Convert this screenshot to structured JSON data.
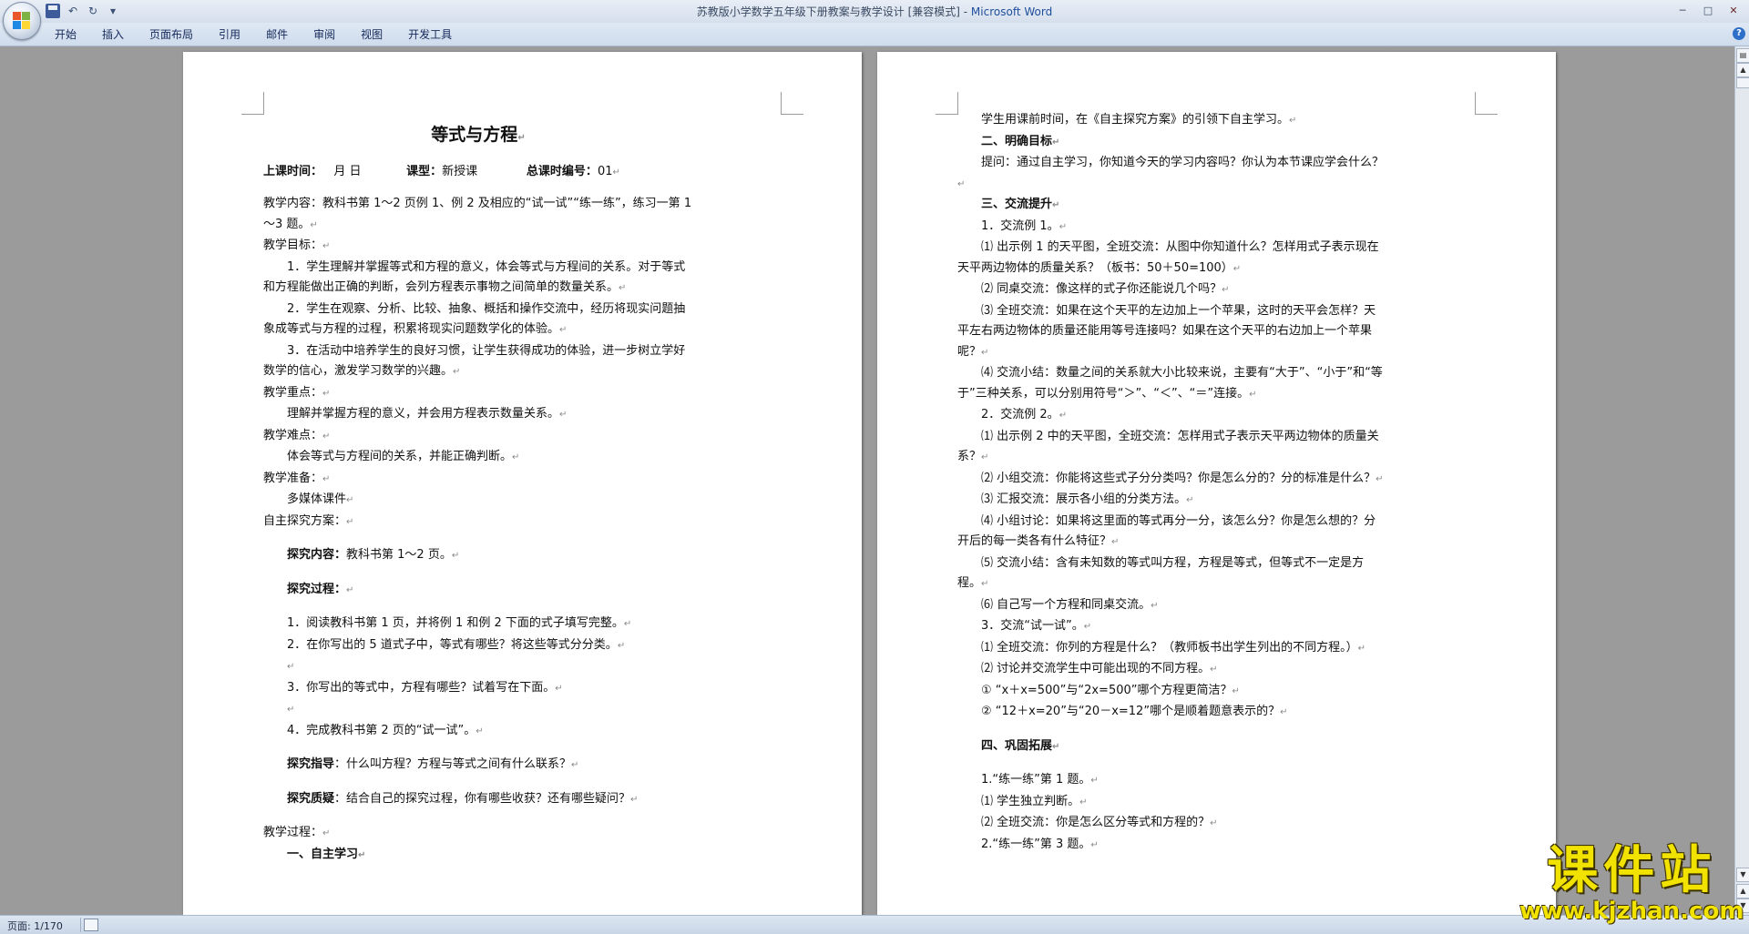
{
  "titlebar": {
    "doc_title": "苏教版小学数学五年级下册教案与教学设计 [兼容模式] - ",
    "app_name": "Microsoft Word",
    "qat_arrow": "▾",
    "minimize": "─",
    "maximize": "□",
    "close": "✕"
  },
  "ribbon": {
    "tabs": [
      "开始",
      "插入",
      "页面布局",
      "引用",
      "邮件",
      "审阅",
      "视图",
      "开发工具"
    ],
    "help": "?"
  },
  "left_page": {
    "title": "等式与方程",
    "info": {
      "time_label": "上课时间：",
      "time_value": "月  日",
      "type_label": "课型：",
      "type_value": "新授课",
      "num_label": "总课时编号：",
      "num_value": "01"
    },
    "lines": [
      "教学内容：教科书第 1～2 页例 1、例 2 及相应的“试一试”“练一练”，练习一第 1～3 题。",
      "教学目标：",
      "1．学生理解并掌握等式和方程的意义，体会等式与方程间的关系。对于等式和方程能做出正确的判断，会列方程表示事物之间简单的数量关系。",
      "2．学生在观察、分析、比较、抽象、概括和操作交流中，经历将现实问题抽象成等式与方程的过程，积累将现实问题数学化的体验。",
      "3．在活动中培养学生的良好习惯，让学生获得成功的体验，进一步树立学好数学的信心，激发学习数学的兴趣。",
      "教学重点：",
      "理解并掌握方程的意义，并会用方程表示数量关系。",
      "教学难点：",
      "体会等式与方程间的关系，并能正确判断。",
      "教学准备：",
      "多媒体课件",
      "自主探究方案："
    ],
    "explore_content_label": "探究内容：",
    "explore_content": "教科书第 1～2 页。",
    "explore_process_label": "探究过程：",
    "steps": [
      "1．阅读教科书第 1 页，并将例 1 和例 2 下面的式子填写完整。",
      "2．在你写出的 5 道式子中，等式有哪些？将这些等式分分类。",
      "3．你写出的等式中，方程有哪些？试着写在下面。",
      "4．完成教科书第 2 页的“试一试”。"
    ],
    "guide_label": "探究指导",
    "guide_text": "：什么叫方程？方程与等式之间有什么联系？",
    "question_label": "探究质疑",
    "question_text": "：结合自己的探究过程，你有哪些收获？还有哪些疑问？",
    "process_label": "教学过程：",
    "section1": "一、自主学习"
  },
  "right_page": {
    "lines": [
      "学生用课前时间，在《自主探究方案》的引领下自主学习。",
      "二、明确目标",
      "提问：通过自主学习，你知道今天的学习内容吗？你认为本节课应学会什么？",
      "三、交流提升",
      "1．交流例 1。",
      "⑴ 出示例 1 的天平图，全班交流：从图中你知道什么？怎样用式子表示现在天平两边物体的质量关系？（板书：50＋50=100）",
      "⑵ 同桌交流：像这样的式子你还能说几个吗？",
      "⑶ 全班交流：如果在这个天平的左边加上一个苹果，这时的天平会怎样？天平左右两边物体的质量还能用等号连接吗？如果在这个天平的右边加上一个苹果呢？",
      "⑷ 交流小结：数量之间的关系就大小比较来说，主要有“大于”、“小于”和“等于”三种关系，可以分别用符号“＞”、“＜”、“＝”连接。",
      "2．交流例 2。",
      "⑴ 出示例 2 中的天平图，全班交流：怎样用式子表示天平两边物体的质量关系？",
      "⑵ 小组交流：你能将这些式子分分类吗？你是怎么分的？分的标准是什么？",
      "⑶ 汇报交流：展示各小组的分类方法。",
      "⑷ 小组讨论：如果将这里面的等式再分一分，该怎么分？你是怎么想的？分开后的每一类各有什么特征？",
      "⑸ 交流小结：含有未知数的等式叫方程，方程是等式，但等式不一定是方程。",
      "⑹ 自己写一个方程和同桌交流。",
      "3．交流“试一试”。",
      "⑴ 全班交流：你列的方程是什么？（教师板书出学生列出的不同方程。）",
      "⑵ 讨论并交流学生中可能出现的不同方程。",
      "① “x＋x=500”与“2x=500”哪个方程更简洁？",
      "②  “12＋x=20”与“20－x=12”哪个是顺着题意表示的？",
      "四、巩固拓展",
      "1.“练一练”第 1 题。",
      "⑴ 学生独立判断。",
      "⑵ 全班交流：你是怎么区分等式和方程的？",
      "2.“练一练”第 3 题。"
    ]
  },
  "paragraph_mark": "↵",
  "statusbar": {
    "page_count": "页面: 1/170"
  },
  "watermark": {
    "main": "课件站",
    "url": "www.kjzhan.com"
  }
}
